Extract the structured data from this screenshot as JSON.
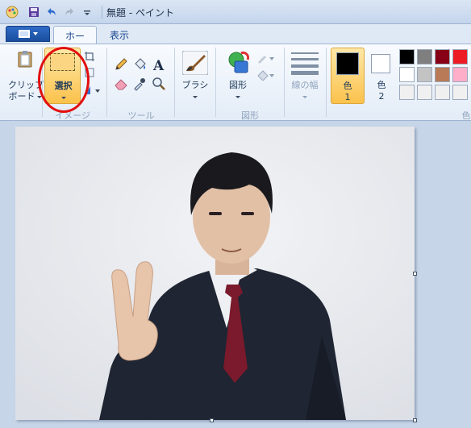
{
  "window": {
    "title": "無題 - ペイント"
  },
  "tabs": {
    "home": "ホーム",
    "view": "表示"
  },
  "ribbon": {
    "clipboard": {
      "label": "クリップボード",
      "label_line1": "クリップ",
      "label_line2": "ボード"
    },
    "image": {
      "select_label": "選択",
      "group_label": "イメージ"
    },
    "tools": {
      "group_label": "ツール"
    },
    "brushes": {
      "label": "ブラシ"
    },
    "shapes": {
      "label": "図形",
      "group_label": "図形"
    },
    "line_width": {
      "label": "線の幅"
    },
    "color1": {
      "line1": "色",
      "line2": "1",
      "value": "#000000"
    },
    "color2": {
      "line1": "色",
      "line2": "2",
      "value": "#ffffff"
    },
    "colors_group_label_partial": "色",
    "palette": [
      "#000000",
      "#7f7f7f",
      "#880015",
      "#ed1c24",
      "#ffffff",
      "#c3c3c3",
      "#b97a57",
      "#ffaec9",
      "#f0f0f0",
      "#f0f0f0",
      "#f0f0f0",
      "#f0f0f0"
    ]
  },
  "annotation": {
    "circle_color": "#e20f0f"
  }
}
